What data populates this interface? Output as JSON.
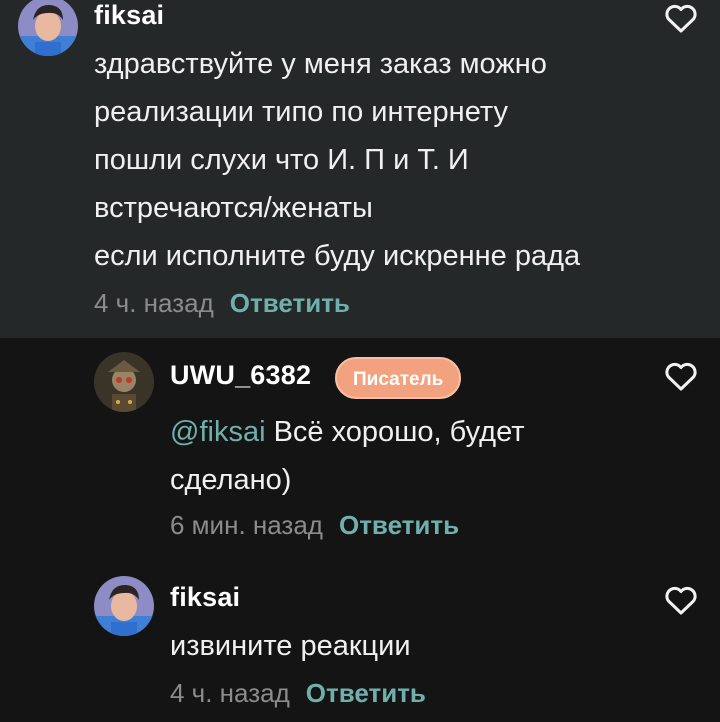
{
  "comments": [
    {
      "username": "fiksai",
      "lines": [
        "здравствуйте у меня заказ можно",
        "реализации типо по интернету",
        "пошли слухи что И. П и Т. И",
        "встречаются/женаты",
        "если исполните буду искренне рада"
      ],
      "time": "4 ч. назад",
      "reply_label": "Ответить"
    },
    {
      "username": "UWU_6382",
      "badge": "Писатель",
      "mention": "@fiksai",
      "lines": [
        "Всё хорошо, будет",
        "сделано)"
      ],
      "time": "6 мин. назад",
      "reply_label": "Ответить"
    },
    {
      "username": "fiksai",
      "lines": [
        "извините реакции"
      ],
      "time": "4 ч. назад",
      "reply_label": "Ответить"
    }
  ],
  "icons": {
    "like": "heart-outline-icon"
  },
  "colors": {
    "top_comment_bg": "#242829",
    "page_bg": "#141414",
    "accent": "#6fb0ac",
    "badge": "#f3a27f"
  }
}
